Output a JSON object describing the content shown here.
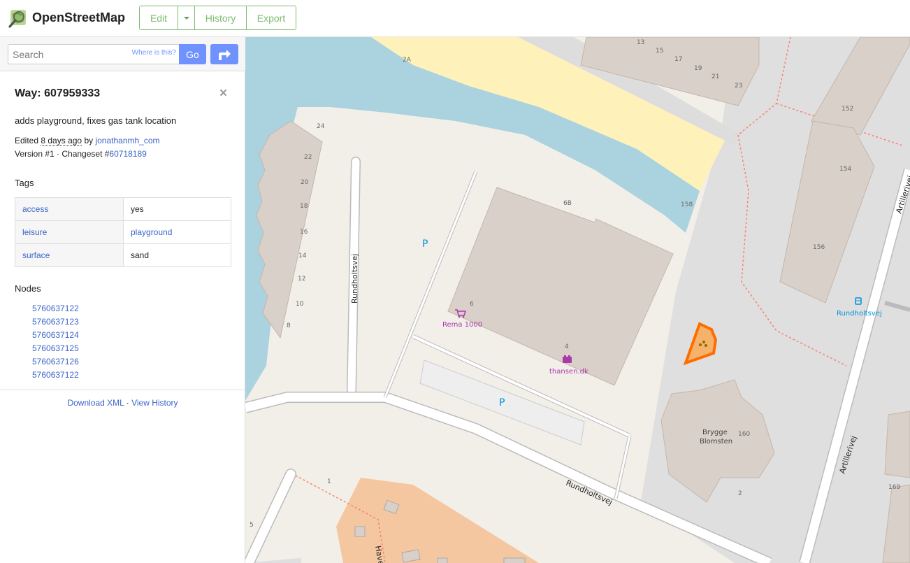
{
  "header": {
    "brand": "OpenStreetMap",
    "edit_label": "Edit",
    "history_label": "History",
    "export_label": "Export"
  },
  "search": {
    "placeholder": "Search",
    "where_label": "Where is this?",
    "go_label": "Go"
  },
  "feature": {
    "title": "Way: 607959333",
    "comment": "adds playground, fixes gas tank location",
    "edited_prefix": "Edited",
    "edited_ago": "8 days ago",
    "edited_by": "by",
    "user": "jonathanmh_com",
    "version_prefix": "Version #1 · Changeset #",
    "changeset": "60718189",
    "tags_heading": "Tags",
    "tags": [
      {
        "key": "access",
        "value": "yes"
      },
      {
        "key": "leisure",
        "value": "playground"
      },
      {
        "key": "surface",
        "value": "sand"
      }
    ],
    "nodes_heading": "Nodes",
    "nodes": [
      "5760637122",
      "5760637123",
      "5760637124",
      "5760637125",
      "5760637126",
      "5760637122"
    ],
    "download_xml": "Download XML",
    "footer_sep": "·",
    "view_history": "View History"
  },
  "map": {
    "street_rundholtsvej_1": "Rundholtsvej",
    "street_rundholtsvej_2": "Rundholtsvej",
    "street_artillerivej_1": "Artillerivej",
    "street_artillerivej_2": "Artillerivej",
    "street_have": "Have",
    "poi_rema": "Rema 1000",
    "poi_thansen": "thansen.dk",
    "poi_bus": "Rundholtsvej",
    "building_brygge_1": "Brygge",
    "building_brygge_2": "Blomsten",
    "parking_1": "P",
    "parking_2": "P",
    "housenumbers": [
      "2A",
      "13",
      "15",
      "17",
      "19",
      "21",
      "23",
      "24",
      "22",
      "20",
      "18",
      "16",
      "14",
      "12",
      "10",
      "8",
      "6B",
      "6",
      "4",
      "158",
      "152",
      "154",
      "156",
      "160",
      "2",
      "1",
      "5",
      "169"
    ],
    "colors": {
      "water": "#aad3df",
      "sand": "#fff1ba",
      "building": "#d9d0c9",
      "highlight": "#ff6d00",
      "road": "#ffffff",
      "landuse": "#f2efe9",
      "parkingArea": "#eeeeee",
      "residential": "#e0dfdf",
      "path": "#fa8072",
      "garden": "#f5c7a0"
    }
  }
}
